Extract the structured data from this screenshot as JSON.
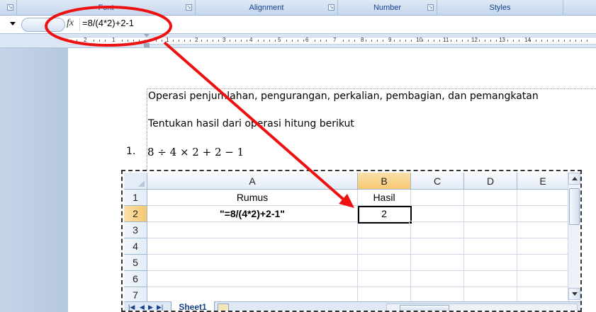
{
  "ribbon": {
    "groups": [
      {
        "label": "Font"
      },
      {
        "label": "Alignment"
      },
      {
        "label": "Number"
      },
      {
        "label": "Styles"
      }
    ]
  },
  "formula_bar": {
    "fx_label": "fx",
    "formula": "=8/(4*2)+2-1"
  },
  "ruler": {
    "numbers": [
      "2",
      "1",
      "1",
      "2",
      "3",
      "4",
      "5",
      "6",
      "7",
      "8",
      "9",
      "10",
      "11",
      "12",
      "13",
      "14"
    ]
  },
  "document": {
    "line1": "Operasi penjumlahan, pengurangan, perkalian, pembagian, dan pemangkatan",
    "line2": "Tentukan hasil dari operasi hitung berikut",
    "list_number": "1.",
    "expression": "8 ÷ 4 × 2 + 2 − 1"
  },
  "spreadsheet": {
    "columns": [
      "A",
      "B",
      "C",
      "D",
      "E"
    ],
    "rows": [
      "1",
      "2",
      "3",
      "4",
      "5",
      "6",
      "7"
    ],
    "cells": {
      "A1": "Rumus",
      "B1": "Hasil",
      "A2": "\"=8/(4*2)+2-1\"",
      "B2": "2"
    },
    "sheet_tab": "Sheet1",
    "nav_buttons": [
      "|◀",
      "◀",
      "▶",
      "▶|"
    ]
  },
  "annotation": {
    "color": "#ee1111"
  }
}
